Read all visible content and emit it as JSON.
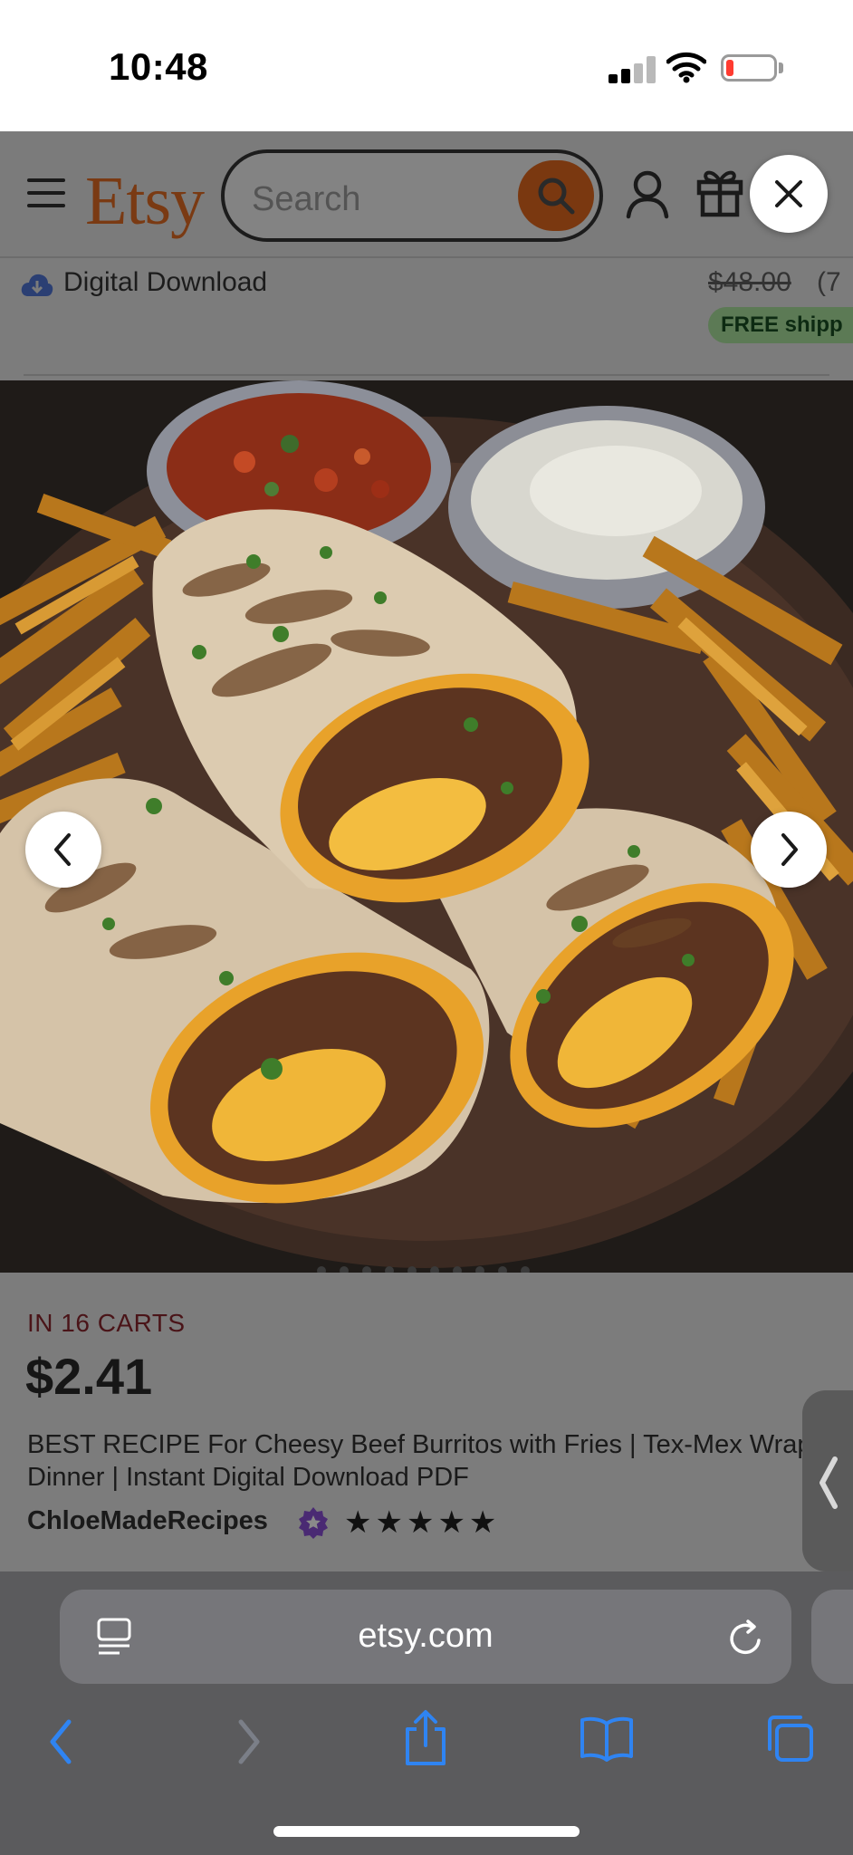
{
  "status_bar": {
    "time": "10:48"
  },
  "header": {
    "logo": "Etsy",
    "search_placeholder": "Search"
  },
  "listing_above": {
    "download_label": "Digital Download",
    "old_price": "$48.00",
    "old_price_tail": "(7",
    "free_shipping": "FREE shipp"
  },
  "listing": {
    "in_carts": "IN 16 CARTS",
    "price": "$2.41",
    "title": "BEST RECIPE For Cheesy Beef Burritos with Fries | Tex-Mex Wrap Dinner | Instant Digital Download PDF",
    "shop_name": "ChloeMadeRecipes",
    "stars": "★★★★★",
    "rating": 5
  },
  "browser": {
    "url": "etsy.com"
  },
  "colors": {
    "etsy_orange": "#F1641E",
    "ios_blue": "#0A84FF",
    "in_carts_red": "#A61A2E",
    "star_seller_purple": "#7B3FB0"
  },
  "icons": {
    "menu": "hamburger-icon",
    "search": "search-icon",
    "account": "account-icon",
    "gift": "gift-icon",
    "close": "close-icon",
    "download": "cloud-download-icon",
    "prev": "chevron-left-icon",
    "next": "chevron-right-icon",
    "reader": "page-menu-icon",
    "reload": "reload-icon",
    "back": "back-icon",
    "forward": "forward-icon",
    "share": "share-icon",
    "bookmarks": "bookmarks-icon",
    "tabs": "tabs-icon"
  }
}
